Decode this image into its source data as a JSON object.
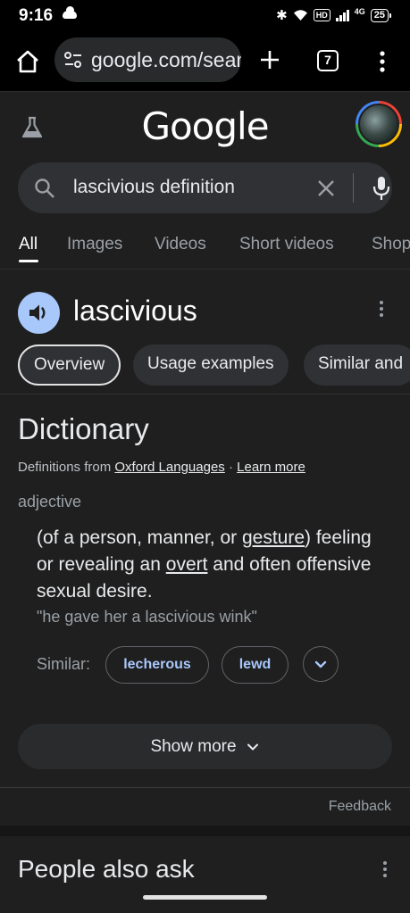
{
  "status_bar": {
    "time": "9:16",
    "hd_badge": "HD",
    "network": "4G",
    "battery": "25"
  },
  "browser": {
    "url": "google.com/sear",
    "tab_count": "7"
  },
  "google": {
    "logo_text": "Google"
  },
  "search": {
    "query": "lascivious definition"
  },
  "tabs": [
    "All",
    "Images",
    "Videos",
    "Short videos",
    "Shop"
  ],
  "word_card": {
    "word": "lascivious",
    "chips": [
      "Overview",
      "Usage examples",
      "Similar and"
    ]
  },
  "dictionary": {
    "title": "Dictionary",
    "source_prefix": "Definitions from",
    "source_name": "Oxford Languages",
    "source_sep": "·",
    "learn_more": "Learn more",
    "part_of_speech": "adjective",
    "definition_parts": {
      "p1": "(of a person, manner, or ",
      "gesture": "gesture",
      "p2": ") feeling or revealing an ",
      "overt": "overt",
      "p3": " and often offensive sexual desire."
    },
    "example": "\"he gave her a lascivious wink\"",
    "similar_label": "Similar:",
    "similar_words": [
      "lecherous",
      "lewd"
    ]
  },
  "show_more": "Show more",
  "feedback": "Feedback",
  "people_also_ask": "People also ask",
  "icons": {
    "home": "home-icon",
    "site_settings": "site-settings-icon",
    "new_tab": "plus-icon",
    "tab_switcher": "tab-switcher-icon",
    "overflow": "more-vert-icon",
    "labs": "flask-icon",
    "search": "search-icon",
    "clear": "close-icon",
    "mic": "mic-icon",
    "speaker": "volume-icon",
    "expand": "chevron-down-icon"
  },
  "colors": {
    "background": "#1f1f1f",
    "chip_link": "#a8c7fa",
    "speaker_bg": "#a8c7fa"
  }
}
